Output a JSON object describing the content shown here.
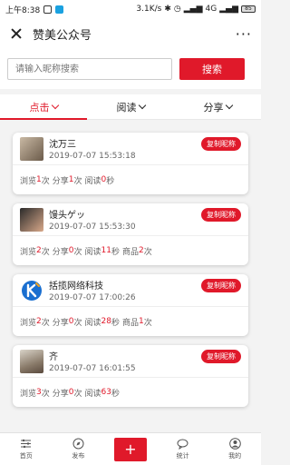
{
  "status_bar": {
    "time": "上午8:38",
    "network_speed": "3.1K/s",
    "network": "4G",
    "battery": "85"
  },
  "header": {
    "title": "赞美公众号",
    "more": "···"
  },
  "search": {
    "placeholder": "请输入昵称搜索",
    "button_label": "搜索"
  },
  "tabs": [
    {
      "label": "点击",
      "active": true
    },
    {
      "label": "阅读",
      "active": false
    },
    {
      "label": "分享",
      "active": false
    }
  ],
  "copy_label": "复制昵称",
  "stat_labels": {
    "browse": "浏览",
    "share": "分享",
    "read": "阅读",
    "goods": "商品",
    "times_unit": "次",
    "seconds_unit": "秒"
  },
  "cards": [
    {
      "name": "沈万三",
      "time": "2019-07-07 15:53:18",
      "browse": "1",
      "share": "1",
      "read": "0",
      "goods": null
    },
    {
      "name": "馒头ゲッ",
      "time": "2019-07-07 15:53:30",
      "browse": "2",
      "share": "0",
      "read": "11",
      "goods": "2"
    },
    {
      "name": "括揽网络科技",
      "time": "2019-07-07 17:00:26",
      "browse": "2",
      "share": "0",
      "read": "28",
      "goods": "1"
    },
    {
      "name": "齐",
      "time": "2019-07-07 16:01:55",
      "browse": "3",
      "share": "0",
      "read": "63",
      "goods": null
    }
  ],
  "bottom_nav": {
    "home": "首页",
    "publish": "发布",
    "plus": "+",
    "stats": "统计",
    "mine": "我的"
  },
  "colors": {
    "accent": "#e0192a"
  }
}
